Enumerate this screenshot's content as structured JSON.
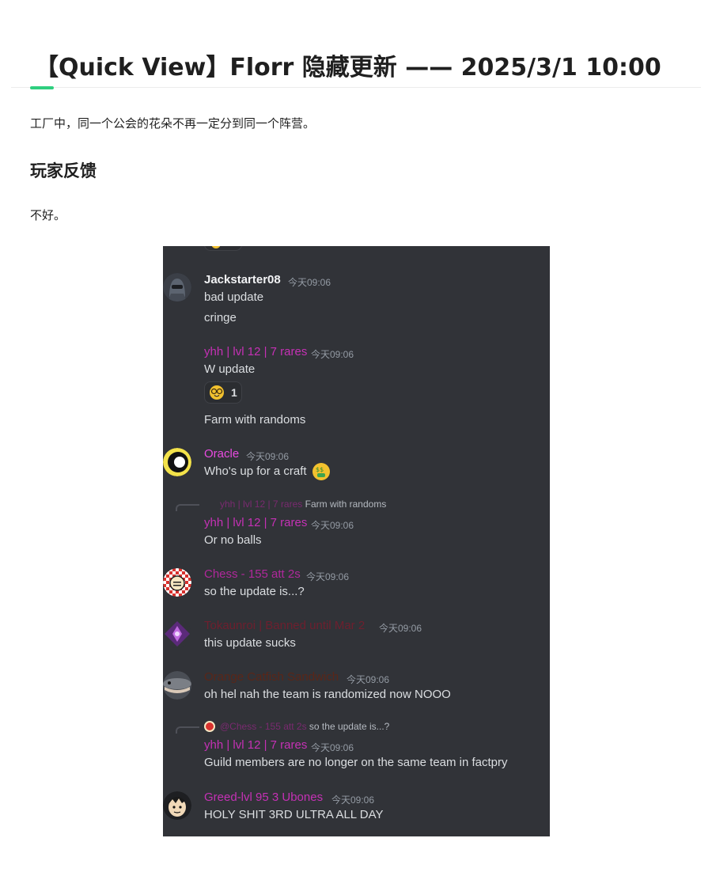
{
  "article": {
    "title": "【Quick View】Florr 隐藏更新 —— 2025/3/1 10:00",
    "intro": "工厂中，同一个公会的花朵不再一定分到同一个阵营。",
    "section_heading": "玩家反馈",
    "section_text": "不好。"
  },
  "colors": {
    "accent": "#2fcf7f",
    "chat_bg": "#313338",
    "name_magenta": "#c531b5",
    "name_pink": "#e84be0",
    "name_dark_red": "#6e1f2e",
    "name_dark_orange": "#5a2618",
    "name_white": "#f2f3f5",
    "timestamp": "#949ba4",
    "message_text": "#dbdee1"
  },
  "chat": {
    "messages": [
      {
        "username": "Jackstarter08",
        "timestamp": "今天09:06",
        "lines": [
          "bad update",
          "cringe"
        ],
        "avatar": "helmet-avatar"
      },
      {
        "username": "yhh | lvl 12 | 7 rares",
        "timestamp": "今天09:06",
        "lines": [
          "W update"
        ],
        "reaction": {
          "emoji": "nerd-face-icon",
          "count": "1"
        },
        "after": "Farm with randoms"
      },
      {
        "username": "Oracle",
        "timestamp": "今天09:06",
        "lines": [
          "Who's up for a craft"
        ],
        "emoji": "money-mouth-icon",
        "avatar": "eye-avatar"
      },
      {
        "reply": {
          "name": "yhh | lvl 12 | 7 rares",
          "text": "Farm with randoms"
        },
        "username": "yhh | lvl 12 | 7 rares",
        "timestamp": "今天09:06",
        "lines": [
          "Or no balls"
        ]
      },
      {
        "username": "Chess - 155 att 2s",
        "timestamp": "今天09:06",
        "lines": [
          "so the update is...?"
        ],
        "avatar": "chess-avatar"
      },
      {
        "username": "Tokaunroi | Banned until Mar 2",
        "timestamp": "今天09:06",
        "lines": [
          "this update sucks"
        ],
        "avatar": "crystal-avatar"
      },
      {
        "username": "Orange Catfish Sandwich",
        "timestamp": "今天09:06",
        "lines": [
          "oh hel nah the team is randomized now NOOO"
        ],
        "avatar": "catfish-avatar"
      },
      {
        "reply": {
          "name": "@Chess - 155 att 2s",
          "text": "so the update is...?"
        },
        "username": "yhh | lvl 12 | 7 rares",
        "timestamp": "今天09:06",
        "lines": [
          "Guild members are no longer on the same team in factpry"
        ]
      },
      {
        "username": "Greed-lvl 95 3 Ubones",
        "timestamp": "今天09:06",
        "lines": [
          "HOLY SHIT 3RD ULTRA ALL DAY"
        ],
        "avatar": "anime-avatar"
      }
    ]
  }
}
